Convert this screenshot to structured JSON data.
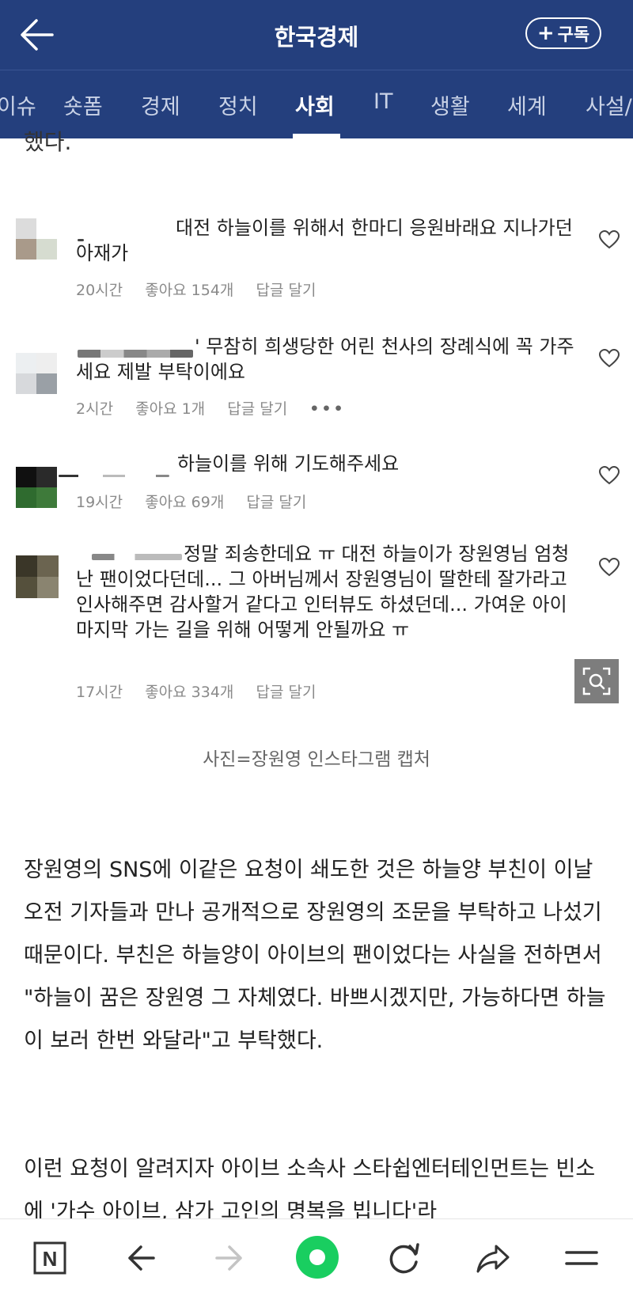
{
  "header": {
    "title": "한국경제",
    "subscribe_label": "구독",
    "subscribe_plus": "+"
  },
  "tabs": [
    {
      "label": "이슈"
    },
    {
      "label": "숏폼"
    },
    {
      "label": "경제"
    },
    {
      "label": "정치"
    },
    {
      "label": "사회",
      "active": true
    },
    {
      "label": "IT"
    },
    {
      "label": "생활"
    },
    {
      "label": "세계"
    },
    {
      "label": "사설/"
    }
  ],
  "article": {
    "partial_top": "했다.",
    "comments": [
      {
        "text": "대전 하늘이를 위해서 한마디 응원바래요 지나가던 아재가",
        "time": "20시간",
        "likes": "좋아요 154개",
        "reply": "답글 달기",
        "avatar_colors": [
          "#dcdcdc",
          "#ffffff",
          "#a99a8a",
          "#d6dcd0"
        ]
      },
      {
        "text": "' 무참히 희생당한 어린 천사의 장례식에 꼭 가주세요 제발 부탁이에요",
        "time": "2시간",
        "likes": "좋아요 1개",
        "reply": "답글 달기",
        "more": "•••",
        "avatar_colors": [
          "#eceff1",
          "#eeeeee",
          "#d7d9dc",
          "#9aa0a6"
        ]
      },
      {
        "text": "하늘이를 위해 기도해주세요",
        "time": "19시간",
        "likes": "좋아요 69개",
        "reply": "답글 달기",
        "avatar_colors": [
          "#101010",
          "#2a2a2a",
          "#2f6b2f",
          "#3e7a3a"
        ]
      },
      {
        "text": "정말 죄송한데요 ㅠ 대전 하늘이가 장원영님 엄청난 팬이었다던데... 그 아버님께서 장원영님이 딸한테 잘가라고 인사해주면 감사할거 같다고 인터뷰도 하셨던데... 가여운 아이 마지막 가는 길을 위해 어떻게 안될까요 ㅠ",
        "time": "17시간",
        "likes": "좋아요 334개",
        "reply": "답글 달기",
        "avatar_colors": [
          "#3a3628",
          "#6b6450",
          "#55503c",
          "#8a8470"
        ]
      }
    ],
    "caption": "사진=장원영 인스타그램 캡처",
    "paragraphs": [
      "장원영의 SNS에 이같은 요청이 쇄도한 것은 하늘양 부친이 이날 오전 기자들과 만나 공개적으로 장원영의 조문을 부탁하고 나섰기 때문이다. 부친은 하늘양이 아이브의 팬이었다는 사실을 전하면서 \"하늘이 꿈은 장원영 그 자체였다. 바쁘시겠지만, 가능하다면 하늘이 보러 한번 와달라\"고 부탁했다.",
      "이런 요청이 알려지자 아이브 소속사 스타쉽엔터테인먼트는 빈소에 '가수 아이브, 삼가 고인의 명복을 빕니다'라"
    ]
  },
  "bottom_bar": {
    "icons": [
      "naver-n-icon",
      "back-arrow-icon",
      "forward-arrow-icon",
      "green-dot-icon",
      "refresh-icon",
      "share-icon",
      "menu-icon"
    ],
    "n_label": "N"
  },
  "colors": {
    "header_bg": "#243f7d",
    "accent_green": "#19ce60"
  }
}
